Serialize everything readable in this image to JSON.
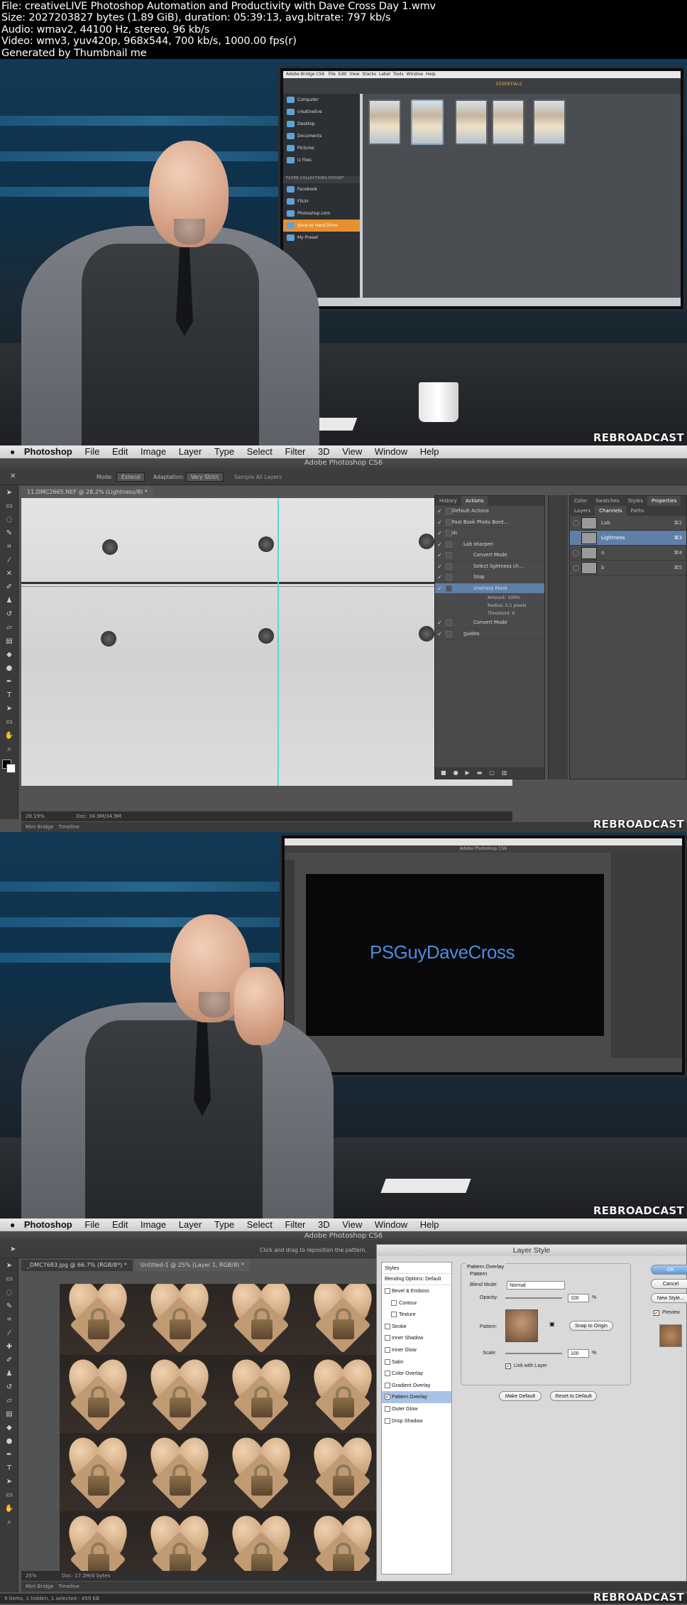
{
  "header": {
    "lines": [
      "File: creativeLIVE Photoshop Automation and Productivity with Dave Cross Day 1.wmv",
      "Size: 2027203827 bytes (1.89 GiB), duration: 05:39:13, avg.bitrate: 797 kb/s",
      "Audio: wmav2, 44100 Hz, stereo, 96 kb/s",
      "Video: wmv3, yuv420p, 968x544, 700 kb/s, 1000.00 fps(r)",
      "Generated by Thumbnail me"
    ]
  },
  "watermark": "REBROADCAST",
  "frame1": {
    "bridge": {
      "title": "Adobe Bridge CS6",
      "menu": [
        "File",
        "Edit",
        "View",
        "Stacks",
        "Label",
        "Tools",
        "Window",
        "Help"
      ],
      "essentials": "ESSENTIALS",
      "favorites": [
        "Computer",
        "creativelive",
        "Desktop",
        "Documents",
        "Pictures",
        "iz Files"
      ],
      "output_tabs": "FILTER   COLLECTIONS   EXPORT",
      "exports": [
        "Facebook",
        "Flickr",
        "Photoshop.com",
        "Save to Hard Drive",
        "My Preset"
      ],
      "selected_export": "Save to Hard Drive"
    }
  },
  "frame2": {
    "menu": {
      "app": "Photoshop",
      "items": [
        "File",
        "Edit",
        "Image",
        "Layer",
        "Type",
        "Select",
        "Filter",
        "3D",
        "View",
        "Window",
        "Help"
      ]
    },
    "title": "Adobe Photoshop CS6",
    "options": {
      "mode_label": "Mode:",
      "mode_value": "Extend",
      "adapt_label": "Adaptation:",
      "adapt_value": "Very Strict",
      "sample_label": "Sample All Layers"
    },
    "doc_tab": "11.DMC2665.NEF @ 28.2% (Lightness/8) *",
    "status": {
      "zoom": "28.19%",
      "doc": "Doc: 34.9M/34.9M"
    },
    "bottom_tabs": [
      "Mini Bridge",
      "Timeline"
    ],
    "actions_panel": {
      "tabs": [
        "History",
        "Actions"
      ],
      "rows": [
        {
          "label": "Default Actions",
          "level": 0
        },
        {
          "label": "Fast Book Photo Bord...",
          "level": 0
        },
        {
          "label": "dc",
          "level": 0
        },
        {
          "label": "Lab sharpen",
          "level": 1
        },
        {
          "label": "Convert Mode",
          "level": 2
        },
        {
          "label": "Select lightness ch...",
          "level": 2
        },
        {
          "label": "Stop",
          "level": 2
        },
        {
          "label": "Unsharp Mask",
          "level": 2,
          "selected": true
        }
      ],
      "details": [
        "Amount: 100%",
        "Radius: 5.1 pixels",
        "Threshold: 0"
      ],
      "after": [
        {
          "label": "Convert Mode",
          "level": 2
        },
        {
          "label": "guides",
          "level": 1
        }
      ]
    },
    "right_panel": {
      "tabs_top": [
        "Color",
        "Swatches",
        "Styles",
        "Properties"
      ],
      "tabs": [
        "Layers",
        "Channels",
        "Paths"
      ],
      "channels": [
        {
          "name": "Lab",
          "shortcut": "⌘2"
        },
        {
          "name": "Lightness",
          "shortcut": "⌘3",
          "selected": true
        },
        {
          "name": "a",
          "shortcut": "⌘4"
        },
        {
          "name": "b",
          "shortcut": "⌘5"
        }
      ]
    }
  },
  "frame3": {
    "monitor_title": "Adobe Photoshop CS6",
    "canvas_text": "PSGuyDaveCross"
  },
  "frame4": {
    "menu": {
      "app": "Photoshop",
      "items": [
        "File",
        "Edit",
        "Image",
        "Layer",
        "Type",
        "Select",
        "Filter",
        "3D",
        "View",
        "Window",
        "Help"
      ]
    },
    "title": "Adobe Photoshop CS6",
    "hint": "Click and drag to reposition the pattern.",
    "doc_tabs": [
      "_DMC7683.jpg @ 66.7% (RGB/8*) *",
      "Untitled-1 @ 25% (Layer 1, RGB/8) *"
    ],
    "status": {
      "zoom": "25%",
      "doc": "Doc: 17.2M/0 bytes",
      "bridge_status": "9 items, 1 hidden, 1 selected - 459 KB"
    },
    "bottom_tabs": [
      "Mini Bridge",
      "Timeline"
    ],
    "layer_style": {
      "title": "Layer Style",
      "styles_header": "Styles",
      "blending": "Blending Options: Default",
      "items": [
        {
          "label": "Bevel & Emboss",
          "checked": false,
          "indent": false
        },
        {
          "label": "Contour",
          "checked": false,
          "indent": true
        },
        {
          "label": "Texture",
          "checked": false,
          "indent": true
        },
        {
          "label": "Stroke",
          "checked": false,
          "indent": false
        },
        {
          "label": "Inner Shadow",
          "checked": false,
          "indent": false
        },
        {
          "label": "Inner Glow",
          "checked": false,
          "indent": false
        },
        {
          "label": "Satin",
          "checked": false,
          "indent": false
        },
        {
          "label": "Color Overlay",
          "checked": false,
          "indent": false
        },
        {
          "label": "Gradient Overlay",
          "checked": false,
          "indent": false
        },
        {
          "label": "Pattern Overlay",
          "checked": true,
          "indent": false,
          "selected": true
        },
        {
          "label": "Outer Glow",
          "checked": false,
          "indent": false
        },
        {
          "label": "Drop Shadow",
          "checked": false,
          "indent": false
        }
      ],
      "section": "Pattern Overlay",
      "subsection": "Pattern",
      "blend_mode_label": "Blend Mode:",
      "blend_mode": "Normal",
      "opacity_label": "Opacity:",
      "opacity": "100",
      "pattern_label": "Pattern:",
      "snap_button": "Snap to Origin",
      "scale_label": "Scale:",
      "scale": "100",
      "link_label": "Link with Layer",
      "make_default": "Make Default",
      "reset_default": "Reset to Default",
      "ok": "OK",
      "cancel": "Cancel",
      "new_style": "New Style...",
      "preview": "Preview"
    }
  }
}
